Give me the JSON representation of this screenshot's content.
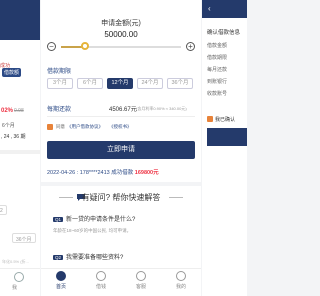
{
  "left": {
    "sub_label": "成功",
    "badge": "借款额",
    "rate": "02%",
    "rate_old": "0.98",
    "line1": "6个月",
    "line2": ", 24 , 36 期",
    "chips": [
      "2",
      "36个月"
    ],
    "footnote": "年化0.5% (折...",
    "nav_label": "我"
  },
  "center": {
    "title": "申请金额(元)",
    "amount": "50000.00",
    "minus": "−",
    "plus": "+",
    "slider_fraction": 0.2,
    "term_label": "借款期限",
    "terms": [
      "3个月",
      "6个月",
      "12个月",
      "24个月",
      "36个月"
    ],
    "active_term_index": 2,
    "repay_label": "每期还款",
    "repay_value": "4506.67元",
    "repay_note": "(含月利率0.90% ≈ 340.00元)",
    "agree_text": "同意",
    "agree_link1": "《用户借款协议》",
    "agree_link2": "《授权书》",
    "apply_label": "立即申请",
    "ticker_prefix": "2022-04-26 : 178****2413 成功借款",
    "ticker_amount": "169800元",
    "faq_title": "有疑问? 帮你快速解答",
    "faq": [
      {
        "tag": "Q1",
        "q": "新一贷的申请条件是什么?",
        "a": "年龄在18~60岁的中国公民, 均可申请。"
      },
      {
        "tag": "Q2",
        "q": "我需要准备哪些资料?",
        "a": ""
      }
    ],
    "nav": [
      {
        "label": "首页",
        "icon": "home-icon"
      },
      {
        "label": "借钱",
        "icon": "money-icon"
      },
      {
        "label": "客服",
        "icon": "service-icon"
      },
      {
        "label": "我的",
        "icon": "user-icon"
      }
    ],
    "active_nav_index": 0
  },
  "right": {
    "back": "‹",
    "title": "确认借款信息",
    "items": [
      "借款金额",
      "借款期限",
      "每月还款",
      "到账银行",
      "收款账号"
    ],
    "confirm_text": "我已确认"
  },
  "colors": {
    "primary": "#243a6b",
    "accent": "#e8833a",
    "red": "#e33344",
    "gold": "#e6b43a"
  }
}
